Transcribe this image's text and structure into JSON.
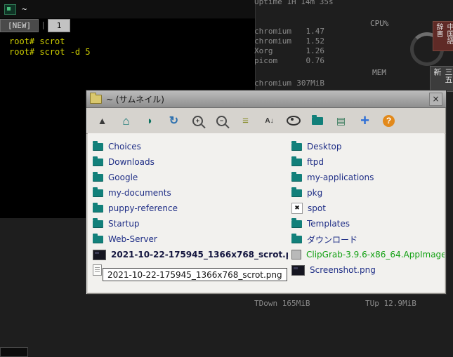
{
  "terminal": {
    "title": "~",
    "tab_new": "[NEW]",
    "tab_divider": "|",
    "tab_1": "1",
    "lines": [
      "root# scrot",
      "root# scrot -d 5"
    ]
  },
  "monitor": {
    "uptime": "Uptime 1H 14m 35s",
    "cpu_header": "CPU%",
    "cpu_rows": [
      {
        "name": "chromium",
        "value": "1.47"
      },
      {
        "name": "chromium",
        "value": "1.52"
      },
      {
        "name": "Xorg",
        "value": "1.26"
      },
      {
        "name": "picom",
        "value": "0.76"
      }
    ],
    "mem_header": "MEM",
    "mem_rows": [
      {
        "name": "chromium",
        "value": "307MiB"
      }
    ],
    "net_down": "TDown 165MiB",
    "net_up": "TUp 12.9MiB"
  },
  "desktop_widgets": {
    "widget1": "中国語辞書",
    "widget2": "三五新"
  },
  "filer": {
    "title": "~ (サムネイル)",
    "close": "×",
    "toolbar": [
      {
        "name": "up",
        "glyph": "▲"
      },
      {
        "name": "home",
        "glyph": "⌂"
      },
      {
        "name": "bookmarks",
        "glyph": "◗"
      },
      {
        "name": "refresh",
        "glyph": "↻"
      },
      {
        "name": "zoom-in",
        "glyph": "+"
      },
      {
        "name": "zoom-out",
        "glyph": "−"
      },
      {
        "name": "list-view",
        "glyph": "≡"
      },
      {
        "name": "sort",
        "glyph": "A↓"
      },
      {
        "name": "show-hidden",
        "glyph": ""
      },
      {
        "name": "new-folder",
        "glyph": ""
      },
      {
        "name": "details",
        "glyph": "▤"
      },
      {
        "name": "new",
        "glyph": "+"
      },
      {
        "name": "help",
        "glyph": "?"
      }
    ],
    "left_items": [
      {
        "label": "Choices"
      },
      {
        "label": "Downloads"
      },
      {
        "label": "Google"
      },
      {
        "label": "my-documents"
      },
      {
        "label": "puppy-reference"
      },
      {
        "label": "Startup"
      },
      {
        "label": "Web-Server"
      },
      {
        "label": "2021-10-22-175945_1366x768_scrot.png"
      },
      {
        "label": ""
      }
    ],
    "right_items": [
      {
        "label": "Desktop"
      },
      {
        "label": "ftpd"
      },
      {
        "label": "my-applications"
      },
      {
        "label": "pkg"
      },
      {
        "label": "spot",
        "icon_glyph": "✖"
      },
      {
        "label": "Templates"
      },
      {
        "label": "ダウンロード"
      },
      {
        "label": "ClipGrab-3.9.6-x86_64.AppImage"
      },
      {
        "label": "Screenshot.png"
      }
    ],
    "tooltip": "2021-10-22-175945_1366x768_scrot.png"
  },
  "colors": {
    "accent_teal": "#12807a",
    "label_navy": "#1f2e86",
    "exec_green": "#12a012",
    "terminal_yellow": "#cdcd00"
  }
}
